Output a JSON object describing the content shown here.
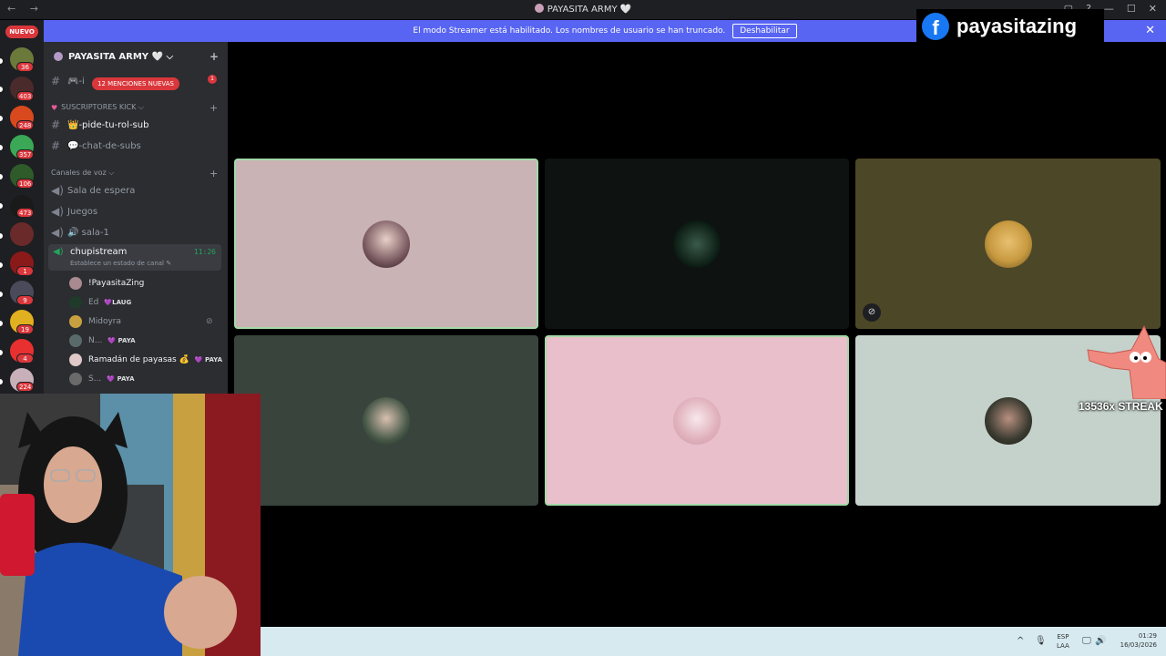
{
  "window": {
    "title": "PAYASITA ARMY 🤍",
    "nav_label": "← →",
    "controls": [
      "▢",
      "?",
      "—",
      "☐",
      "✕"
    ]
  },
  "banner": {
    "text": "El modo Streamer está habilitado. Los nombres de usuario se han truncado.",
    "button_label": "Deshabilitar",
    "close": "✕"
  },
  "overlay": {
    "fb_glyph": "f",
    "fb_name": "payasitazing",
    "streak_text": "13536x STREAK"
  },
  "rail": {
    "new_label": "NUEVO",
    "badges": [
      "36",
      "403",
      "248",
      "357",
      "106",
      "473",
      "1",
      "9",
      "19",
      "4",
      "224"
    ]
  },
  "server": {
    "name": "PAYASITA ARMY 🤍 ⌵",
    "add_icon": "+"
  },
  "channels": {
    "first": "🎮-i",
    "mentions_pill": "12 MENCIONES NUEVAS",
    "unread": "1",
    "category_subs": "SUSCRIPTORES KICK ⌵",
    "sub_channels": [
      "👑-pide-tu-rol-sub",
      "💬-chat-de-subs"
    ],
    "category_voice": "Canales de voz ⌵",
    "voice_channels": [
      "Sala de espera",
      "Juegos",
      "🔊 sala-1"
    ],
    "active_voice": {
      "name": "chupistream",
      "timer": "11:26",
      "status": "Establece un estado de canal ✎"
    },
    "voice_users": [
      {
        "name": "!PayasitaZing",
        "tag": ""
      },
      {
        "name": "Ed",
        "tag": "💜LAUG"
      },
      {
        "name": "Midoyra",
        "tag": ""
      },
      {
        "name": "N...",
        "tag": "💜 PAYA"
      },
      {
        "name": "Ramadán de payasas 💰",
        "tag": "💜 PAYA"
      },
      {
        "name": "S...",
        "tag": "💜 PAYA"
      }
    ]
  },
  "taskbar": {
    "lang_top": "ESP",
    "lang_bottom": "LAA",
    "time": "01:29",
    "date": "16/03/2026",
    "icons": [
      "^",
      "🎙",
      "🖵",
      "🔊"
    ]
  },
  "colors": {
    "accent": "#5865f2",
    "danger": "#da373c",
    "speaking": "#a3d9a8"
  }
}
